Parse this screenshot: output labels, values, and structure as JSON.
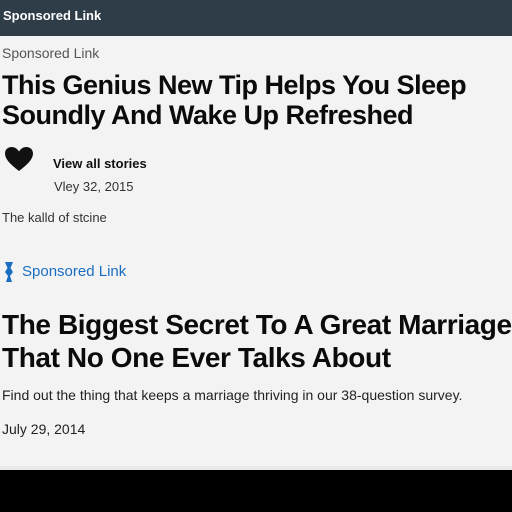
{
  "header": {
    "label": "Sponsored Link"
  },
  "ad1": {
    "label": "Sponsored Link",
    "headline": "This Genius New Tip Helps You Sleep Soundly And Wake Up Refreshed",
    "icon": "heart-icon",
    "view_all": "View all stories",
    "date": "Vley 32, 2015",
    "caption": "The kalld of stcine"
  },
  "ad2": {
    "icon": "bookmark-icon",
    "label": "Sponsored Link",
    "label_color": "#1a6ec2",
    "headline": "The Biggest Secret To A Great Marriage That No One Ever Talks About",
    "description": "Find out the thing that keeps a marriage thriving in our 38-question survey.",
    "date": "July 29, 2014"
  },
  "colors": {
    "topbar": "#2f3d49",
    "background": "#f3f3f4",
    "frame": "#000000"
  }
}
